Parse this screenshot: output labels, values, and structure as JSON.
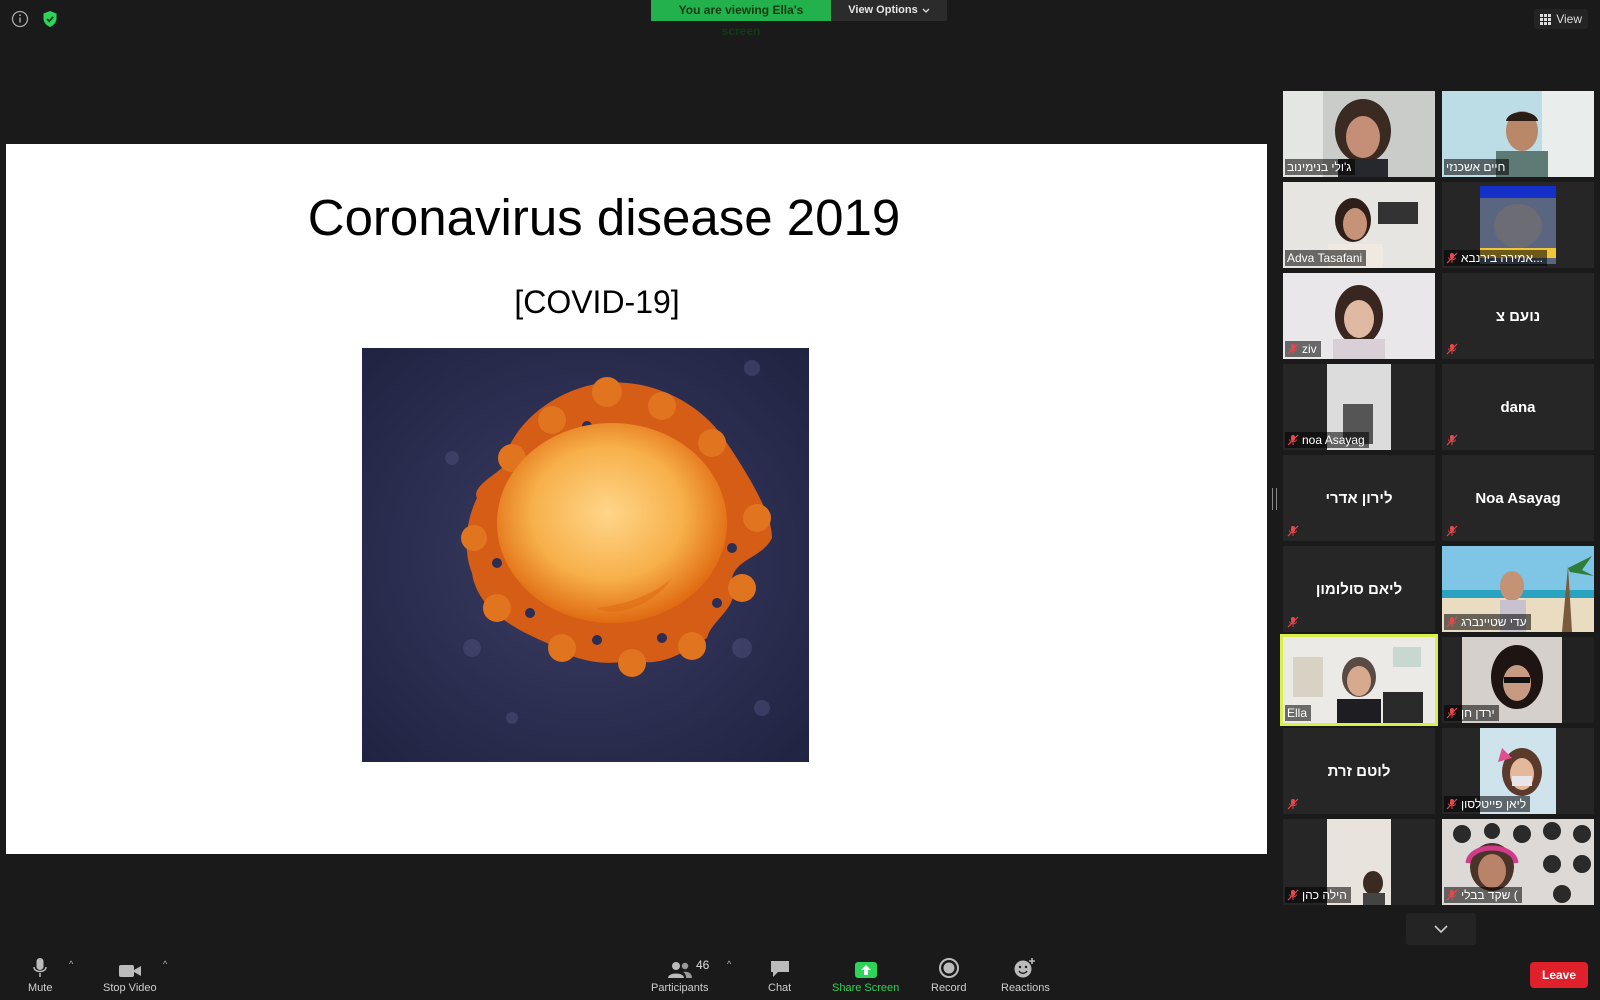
{
  "meeting": {
    "viewing_banner": "You are viewing Ella's screen",
    "view_options_label": "View Options",
    "view_label": "View"
  },
  "slide": {
    "title": "Coronavirus disease 2019",
    "subtitle": "[COVID-19]"
  },
  "participants": [
    {
      "name": "ג'ולי בנימינוב",
      "video": true,
      "muted": false
    },
    {
      "name": "חיים אשכנזי",
      "video": true,
      "muted": false
    },
    {
      "name": "Adva Tasafani",
      "video": true,
      "muted": false
    },
    {
      "name": "אמירה בירנבא...",
      "video": true,
      "muted": true
    },
    {
      "name": "ziv",
      "video": true,
      "muted": true
    },
    {
      "name": "נועם צ",
      "video": false,
      "muted": true
    },
    {
      "name": "noa Asayag",
      "video": true,
      "muted": true
    },
    {
      "name": "dana",
      "video": false,
      "muted": true
    },
    {
      "name": "לירון אדרי",
      "video": false,
      "muted": true
    },
    {
      "name": "Noa Asayag",
      "video": false,
      "muted": true
    },
    {
      "name": "ליאם סולומון",
      "video": false,
      "muted": true
    },
    {
      "name": "עדי שטיינברג",
      "video": true,
      "muted": true
    },
    {
      "name": "Ella",
      "video": true,
      "muted": false,
      "active_speaker": true
    },
    {
      "name": "ירדן חן",
      "video": true,
      "muted": true
    },
    {
      "name": "לוטם זרת",
      "video": false,
      "muted": true
    },
    {
      "name": "ליאן פייטלסון",
      "video": true,
      "muted": true
    },
    {
      "name": "הילה כהן",
      "video": true,
      "muted": true
    },
    {
      "name": "שקד בבלי (",
      "video": true,
      "muted": true
    }
  ],
  "toolbar": {
    "mute_label": "Mute",
    "stop_video_label": "Stop Video",
    "participants_label": "Participants",
    "participants_count": "46",
    "chat_label": "Chat",
    "share_screen_label": "Share Screen",
    "record_label": "Record",
    "reactions_label": "Reactions",
    "leave_label": "Leave"
  },
  "colors": {
    "banner_green": "#23b14d",
    "share_green": "#2dd35b",
    "active_speaker": "#d9f04a",
    "leave_red": "#e0202a",
    "mute_red": "#e5484d"
  }
}
